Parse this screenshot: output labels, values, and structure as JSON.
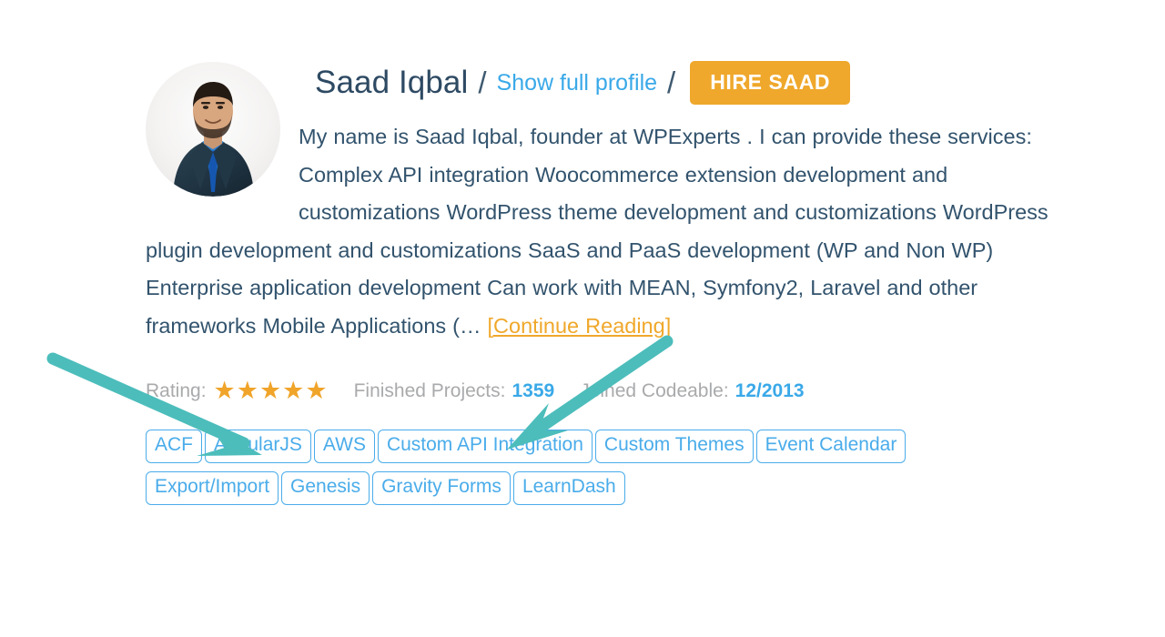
{
  "profile": {
    "name": "Saad Iqbal",
    "separator": "/",
    "show_full_profile_label": "Show full profile",
    "hire_button_label": "HIRE SAAD",
    "avatar_alt": "avatar",
    "bio_text": "My name is Saad Iqbal, founder at WPExperts . I can provide these services: Complex API integration Woocommerce extension development and customizations WordPress theme development and customizations WordPress plugin development and customizations SaaS and PaaS development (WP and Non WP) Enterprise application development Can work with MEAN, Symfony2, Laravel and other frameworks Mobile Applications (…",
    "continue_reading_label": "[Continue Reading]"
  },
  "meta": {
    "rating_label": "Rating:",
    "rating_stars": "★★★★★",
    "rating_value": 5,
    "finished_projects_label": "Finished Projects:",
    "finished_projects_value": "1359",
    "joined_label": "Joined Codeable:",
    "joined_value": "12/2013"
  },
  "tags": [
    "ACF",
    "AngularJS",
    "AWS",
    "Custom API Integration",
    "Custom Themes",
    "Event Calendar",
    "Export/Import",
    "Genesis",
    "Gravity Forms",
    "LearnDash"
  ],
  "annotations": [
    {
      "name": "arrow-to-rating-stars",
      "color": "#4cbdbb"
    },
    {
      "name": "arrow-to-finished-projects",
      "color": "#4cbdbb"
    }
  ],
  "colors": {
    "accent_orange": "#efa82c",
    "link_blue": "#3aa9e8",
    "tag_blue": "#4aacea",
    "name_navy": "#2e4a63",
    "muted_grey": "#a9aaac",
    "annotation_teal": "#4cbdbb",
    "body_navy": "#32536d"
  }
}
